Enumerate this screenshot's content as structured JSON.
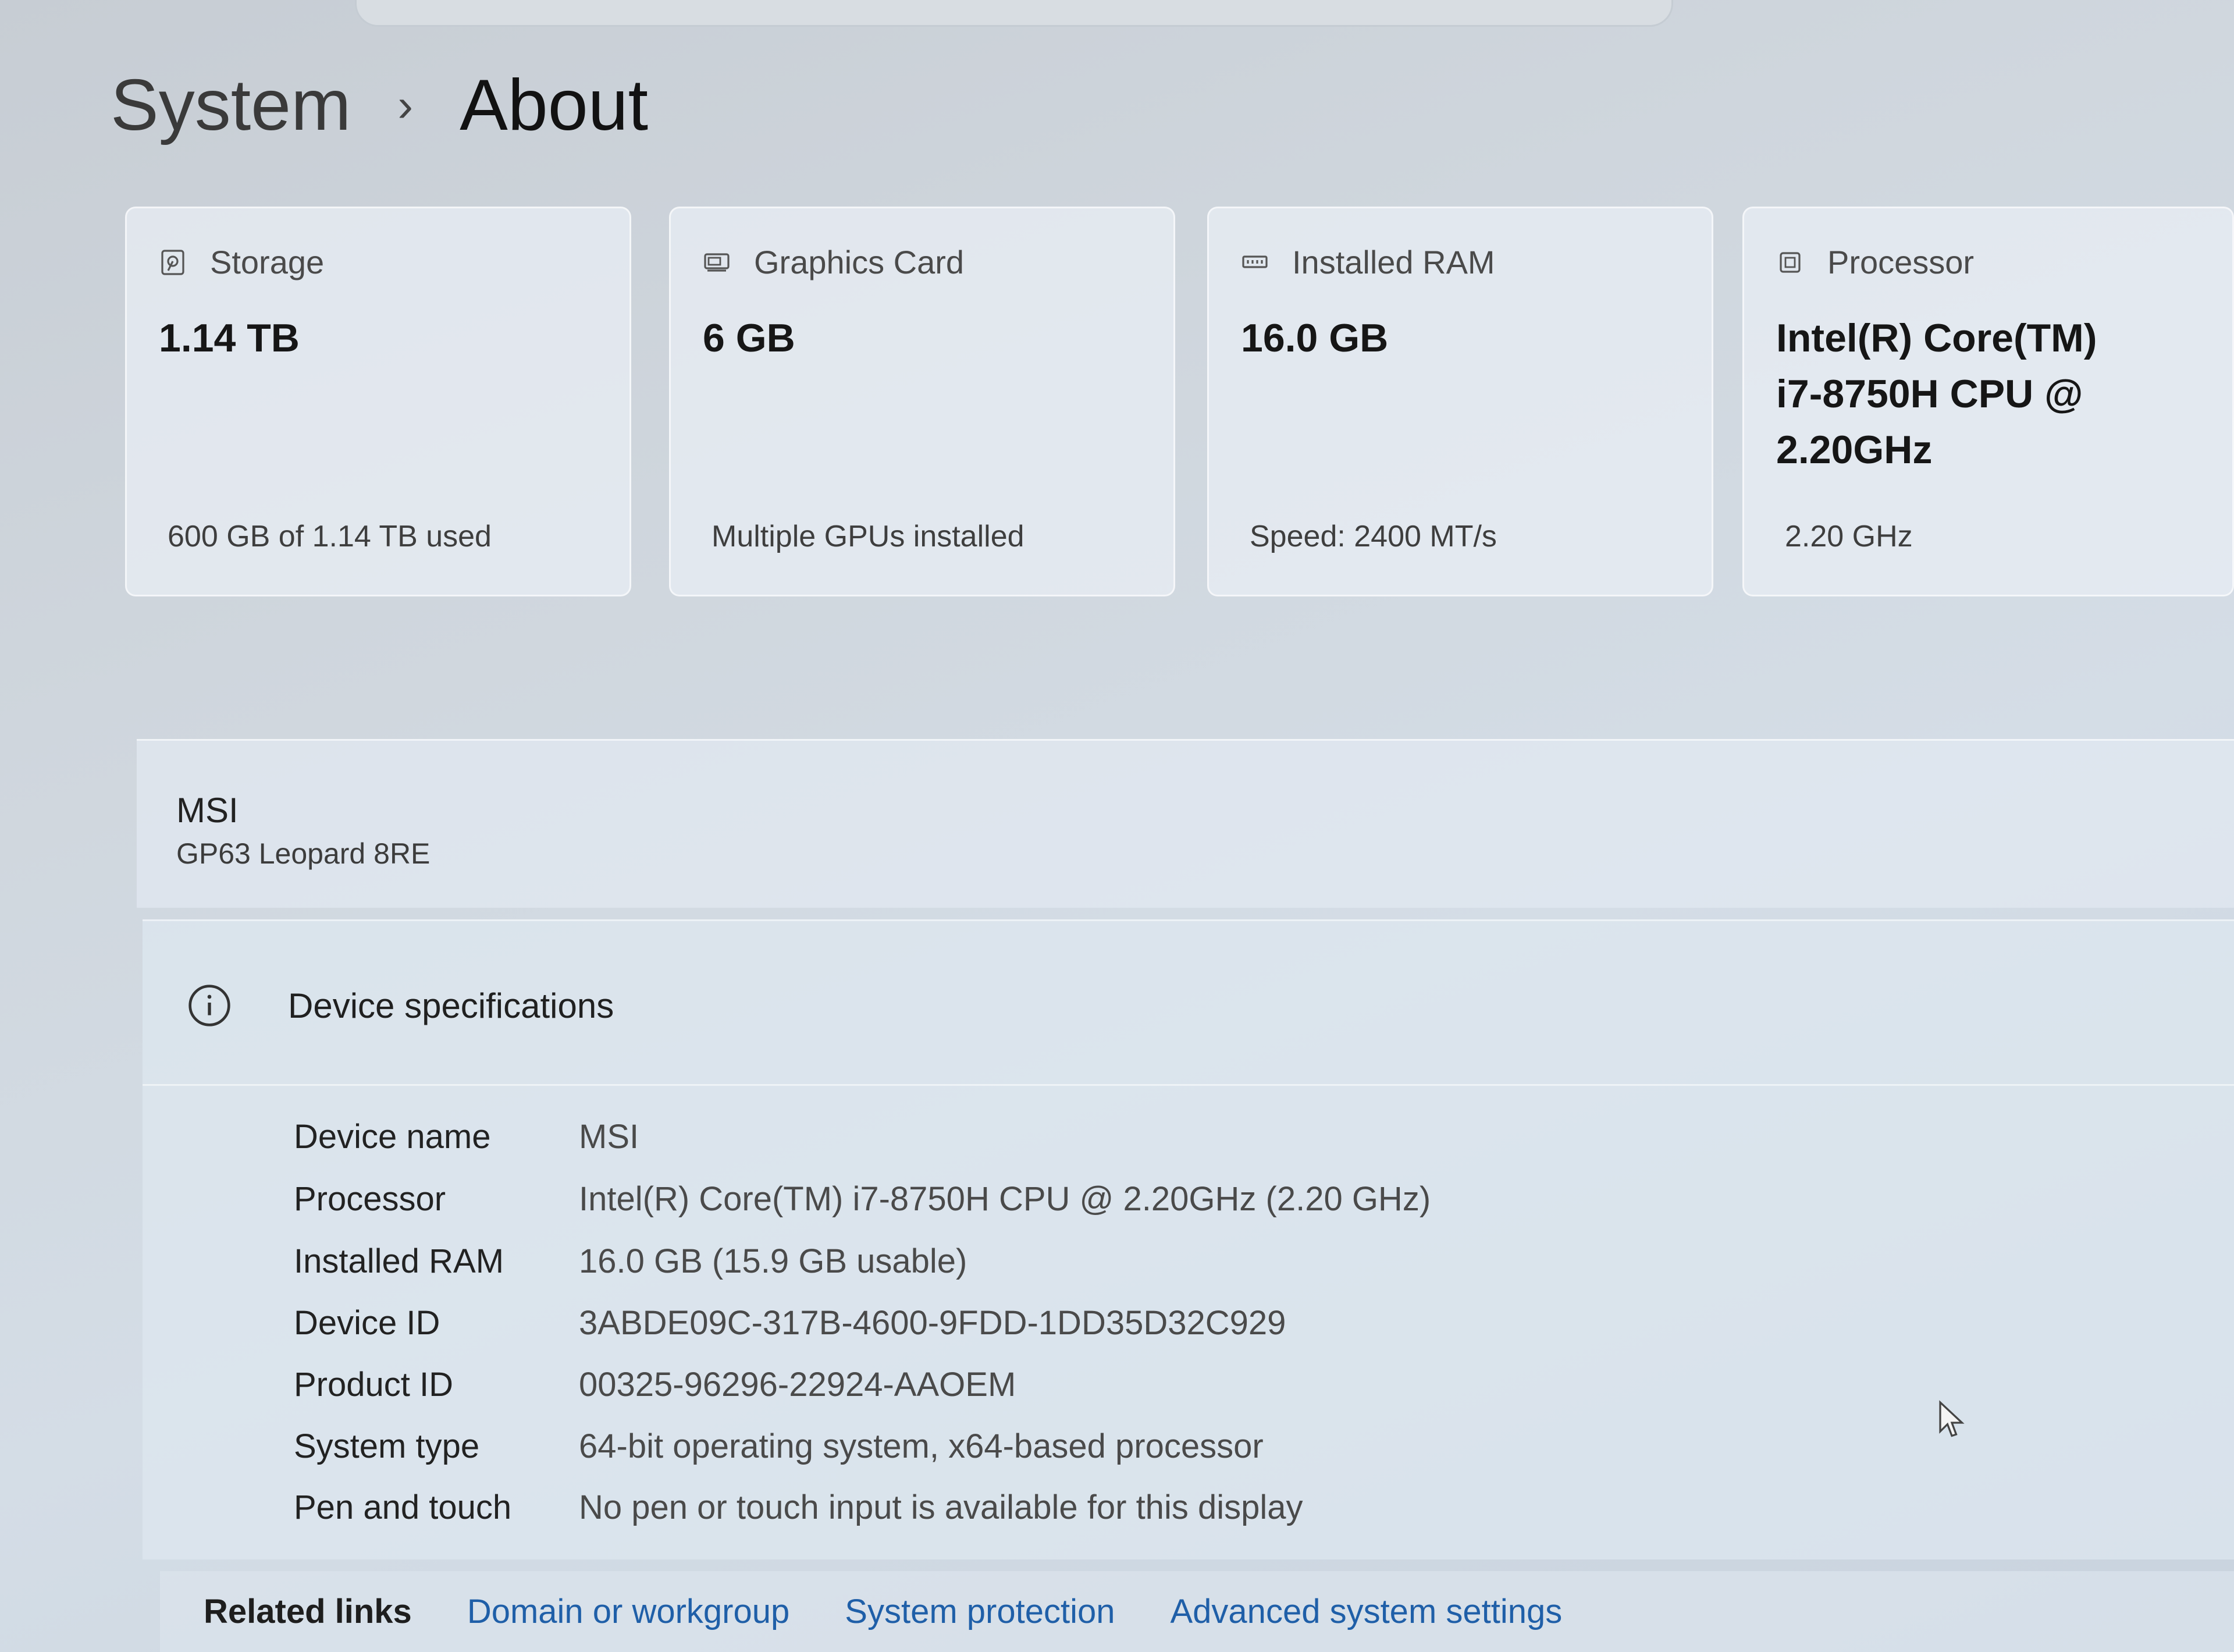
{
  "breadcrumb": {
    "parent": "System",
    "separator": "›",
    "current": "About"
  },
  "cards": [
    {
      "icon": "storage-icon",
      "label": "Storage",
      "value": "1.14 TB",
      "sub": "600 GB of 1.14 TB used"
    },
    {
      "icon": "graphics-card-icon",
      "label": "Graphics Card",
      "value": "6 GB",
      "sub": "Multiple GPUs installed"
    },
    {
      "icon": "ram-icon",
      "label": "Installed RAM",
      "value": "16.0 GB",
      "sub": "Speed: 2400 MT/s"
    },
    {
      "icon": "processor-icon",
      "label": "Processor",
      "value": "Intel(R) Core(TM) i7-8750H CPU @ 2.20GHz",
      "sub": "2.20 GHz"
    }
  ],
  "device": {
    "brand": "MSI",
    "model": "GP63 Leopard 8RE"
  },
  "specs": {
    "title": "Device specifications",
    "rows": [
      {
        "label": "Device name",
        "value": "MSI"
      },
      {
        "label": "Processor",
        "value": "Intel(R) Core(TM) i7-8750H CPU @ 2.20GHz (2.20 GHz)"
      },
      {
        "label": "Installed RAM",
        "value": "16.0 GB (15.9 GB usable)"
      },
      {
        "label": "Device ID",
        "value": "3ABDE09C-317B-4600-9FDD-1DD35D32C929"
      },
      {
        "label": "Product ID",
        "value": "00325-96296-22924-AAOEM"
      },
      {
        "label": "System type",
        "value": "64-bit operating system, x64-based processor"
      },
      {
        "label": "Pen and touch",
        "value": "No pen or touch input is available for this display"
      }
    ]
  },
  "related": {
    "label": "Related links",
    "links": [
      "Domain or workgroup",
      "System protection",
      "Advanced system settings"
    ]
  },
  "colors": {
    "link": "#1f5fa8",
    "card_bg": "#e8eef4"
  }
}
